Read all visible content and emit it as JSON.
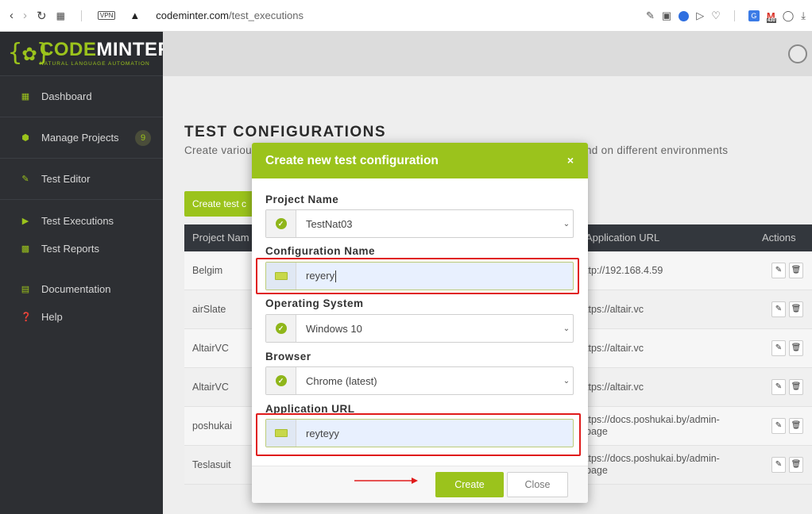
{
  "browser": {
    "vpn": "VPN",
    "url_host": "codeminter.com",
    "url_path": "/test_executions",
    "mail_badge": "430"
  },
  "logo": {
    "title_code": "CODE",
    "title_minter": "MINTER",
    "subtitle": "NATURAL LANGUAGE AUTOMATION"
  },
  "sidebar": {
    "items": [
      {
        "label": "Dashboard"
      },
      {
        "label": "Manage Projects",
        "count": "9"
      },
      {
        "label": "Test Editor"
      },
      {
        "label": "Test Executions"
      },
      {
        "label": "Test Reports"
      },
      {
        "label": "Documentation"
      },
      {
        "label": "Help"
      }
    ]
  },
  "page": {
    "title": "TEST CONFIGURATIONS",
    "description_start": "Create variou",
    "description_end": "nd on different environments",
    "create_button": "Create test c"
  },
  "table": {
    "headers": {
      "project": "Project Nam",
      "url": "Application URL",
      "actions": "Actions"
    },
    "rows": [
      {
        "project": "Belgim",
        "url": "ttp://192.168.4.59"
      },
      {
        "project": "airSlate",
        "url": "ttps://altair.vc"
      },
      {
        "project": "AltairVC",
        "url": "ttps://altair.vc"
      },
      {
        "project": "AltairVC",
        "url": "ttps://altair.vc"
      },
      {
        "project": "poshukai",
        "url": "ttps://docs.poshukai.by/admin-page",
        "url_line1": "ttps://docs.poshukai.by/admin-",
        "url_line2": "page"
      },
      {
        "project": "Teslasuit",
        "url": "ttps://docs.poshukai.by/admin-page",
        "url_line1": "ttps://docs.poshukai.by/admin-",
        "url_line2": "page"
      }
    ]
  },
  "modal": {
    "title": "Create new test configuration",
    "close_icon": "×",
    "fields": {
      "project_name": {
        "label": "Project Name",
        "value": "TestNat03"
      },
      "configuration_name": {
        "label": "Configuration Name",
        "value": "reyery"
      },
      "operating_system": {
        "label": "Operating System",
        "value": "Windows 10"
      },
      "browser": {
        "label": "Browser",
        "value": "Chrome (latest)"
      },
      "application_url": {
        "label": "Application URL",
        "value": "reyteyy"
      }
    },
    "buttons": {
      "create": "Create",
      "close": "Close"
    }
  },
  "colors": {
    "accent": "#9bc31c",
    "sidebar": "#2d2f33",
    "annotation": "#e01b1b"
  }
}
